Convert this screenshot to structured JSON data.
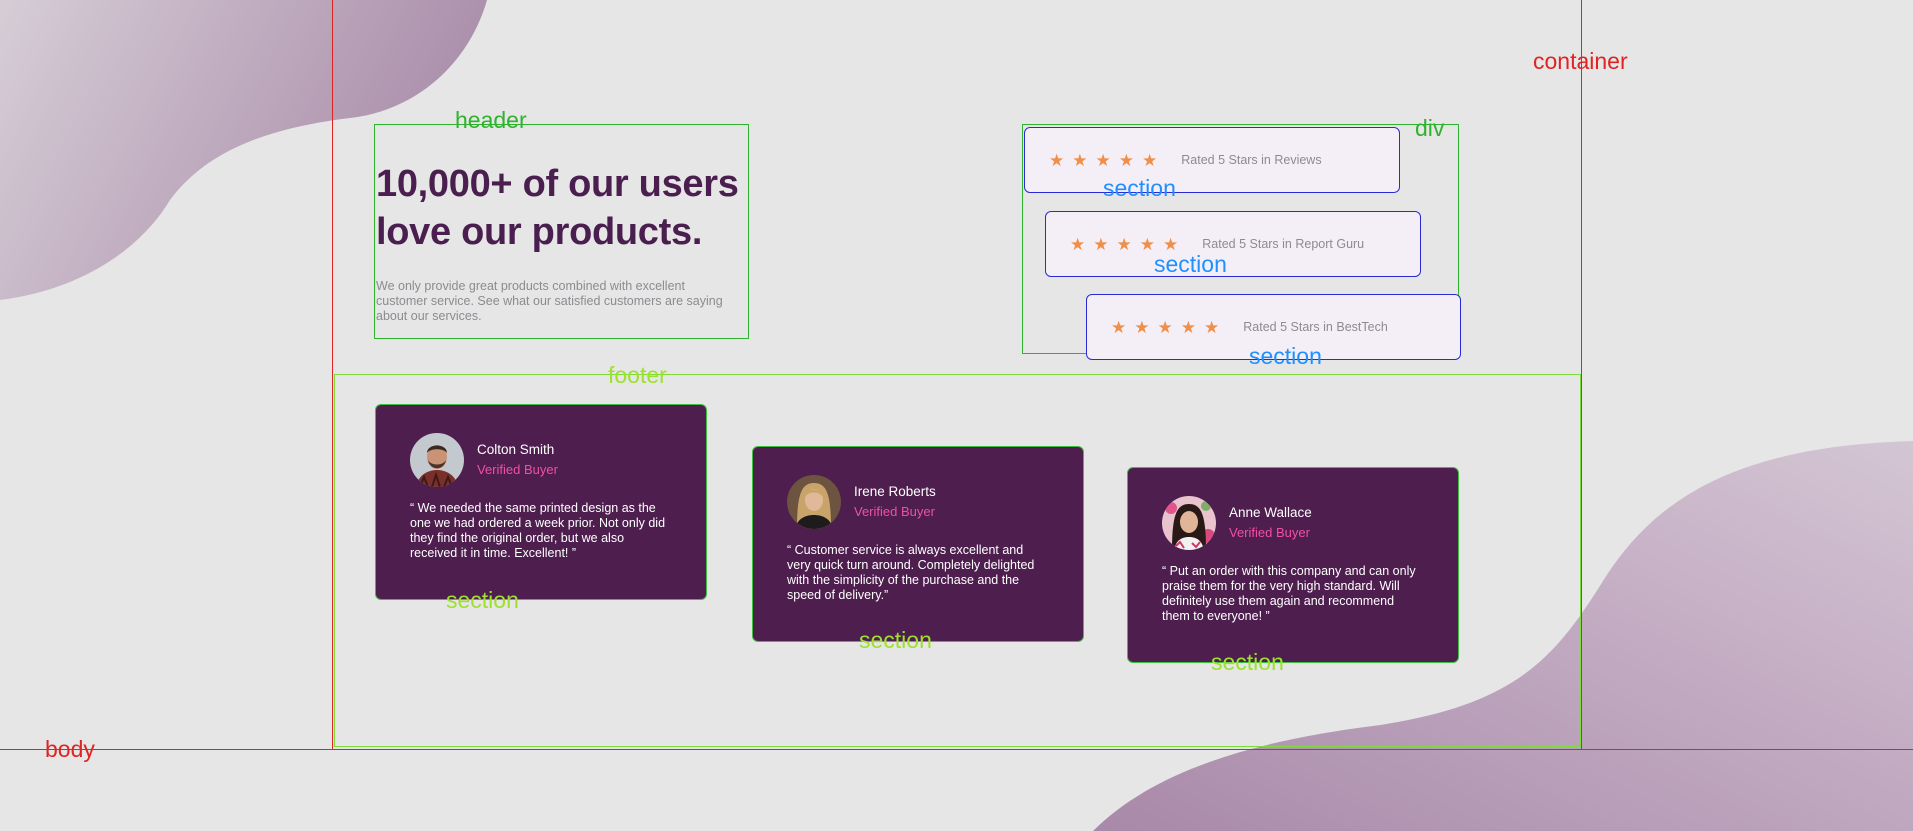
{
  "colors": {
    "background": "#e6e6e6",
    "blob": "#b69cb6",
    "headline": "#4a1f4f",
    "muted_text": "#8e8a90",
    "card_background": "#4e1e4f",
    "badge_pink": "#f04fa6",
    "star_orange": "#ef8f4a",
    "rating_background": "#f4eff6",
    "debug_red": "#e02424",
    "debug_green": "#2fb32f",
    "debug_blue": "#2b2bd6"
  },
  "debug_labels": {
    "container": "container",
    "header": "header",
    "div": "div",
    "footer": "footer",
    "body": "body",
    "section": "section"
  },
  "header": {
    "title_line1": "10,000+ of our users",
    "title_line2": "love our products.",
    "description": "We only provide great products combined with excellent customer service. See what our satisfied customers are saying about our services."
  },
  "ratings": [
    {
      "stars": 5,
      "label": "Rated 5 Stars in Reviews"
    },
    {
      "stars": 5,
      "label": "Rated 5 Stars in Report Guru"
    },
    {
      "stars": 5,
      "label": "Rated 5 Stars in BestTech"
    }
  ],
  "testimonials": [
    {
      "name": "Colton Smith",
      "badge": "Verified Buyer",
      "avatar_icon": "man-portrait-icon",
      "quote": "“ We needed the same printed design as the one we had ordered a week prior. Not only did they find the original order, but we also received it in time. Excellent! ”"
    },
    {
      "name": "Irene Roberts",
      "badge": "Verified Buyer",
      "avatar_icon": "woman-portrait-icon",
      "quote": "“ Customer service is always excellent and very quick turn around. Completely delighted with the simplicity of the purchase and the speed of delivery.”"
    },
    {
      "name": "Anne Wallace",
      "badge": "Verified Buyer",
      "avatar_icon": "woman-portrait-icon",
      "quote": "“ Put an order with this company and can only praise them for the very high standard. Will definitely use them again and recommend them to everyone! ”"
    }
  ]
}
